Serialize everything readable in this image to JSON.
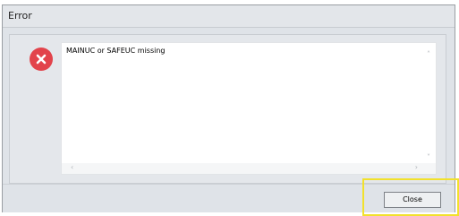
{
  "window": {
    "title": "Error"
  },
  "message": {
    "text": "MAINUC or SAFEUC missing",
    "icon": "error-x-icon"
  },
  "scrollbar": {
    "up": "˄",
    "down": "˅",
    "left": "‹",
    "right": "›"
  },
  "buttons": {
    "close_label": "Close"
  },
  "colors": {
    "error_icon": "#e2434b",
    "highlight": "#f2e12c"
  }
}
